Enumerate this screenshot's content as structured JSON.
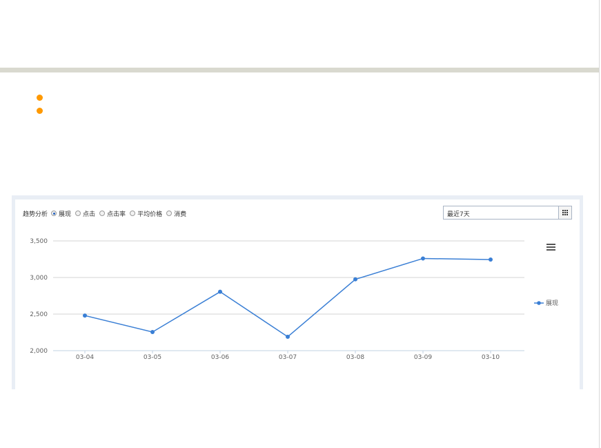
{
  "toolbar": {
    "label": "趋势分析",
    "options": [
      "展现",
      "点击",
      "点击率",
      "平均价格",
      "消费"
    ],
    "selected_index": 0
  },
  "date_range": {
    "value": "最近7天",
    "calendar_icon": "calendar-grid-icon"
  },
  "menu_icon": "hamburger-menu-icon",
  "bullet_color": "#ff9900",
  "chart_data": {
    "type": "line",
    "categories": [
      "03-04",
      "03-05",
      "03-06",
      "03-07",
      "03-08",
      "03-09",
      "03-10"
    ],
    "series": [
      {
        "name": "展现",
        "values": [
          2480,
          2255,
          2805,
          2190,
          2975,
          3260,
          3245
        ],
        "color": "#3a7fd5"
      }
    ],
    "ylim": [
      2000,
      3500
    ],
    "yticks": [
      2000,
      2500,
      3000,
      3500
    ],
    "ytick_labels": [
      "2,000",
      "2,500",
      "3,000",
      "3,500"
    ],
    "grid": true,
    "legend": "right"
  }
}
